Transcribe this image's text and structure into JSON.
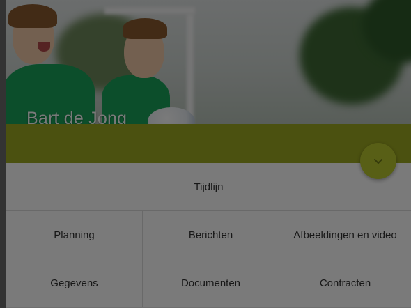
{
  "profile": {
    "name": "Bart de Jong"
  },
  "colors": {
    "accent_band": "#9eaa22",
    "fab": "#b8c62e",
    "shirt_green": "#1aa35a"
  },
  "expand_button": {
    "icon": "chevron-down-icon"
  },
  "menu": {
    "primary": "Tijdlijn",
    "items": [
      {
        "label": "Planning"
      },
      {
        "label": "Berichten"
      },
      {
        "label": "Afbeeldingen en video"
      },
      {
        "label": "Gegevens"
      },
      {
        "label": "Documenten"
      },
      {
        "label": "Contracten"
      }
    ]
  }
}
